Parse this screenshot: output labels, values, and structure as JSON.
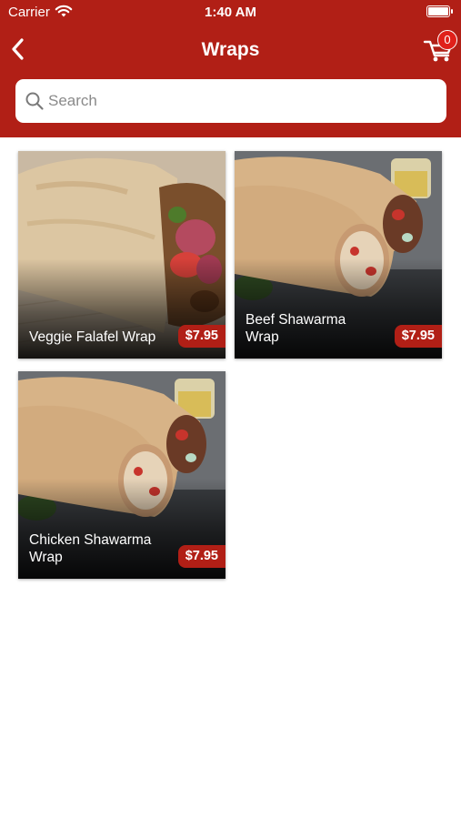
{
  "status_bar": {
    "carrier": "Carrier",
    "time": "1:40 AM"
  },
  "header": {
    "title": "Wraps",
    "cart_count": "0"
  },
  "search": {
    "placeholder": "Search",
    "value": ""
  },
  "products": [
    {
      "name": "Veggie Falafel Wrap",
      "price": "$7.95"
    },
    {
      "name": "Beef Shawarma Wrap",
      "price": "$7.95"
    },
    {
      "name": "Chicken Shawarma Wrap",
      "price": "$7.95"
    }
  ],
  "colors": {
    "brand": "#b11f16",
    "badge": "#e0201a",
    "background": "#ffffff"
  },
  "icons": [
    "wifi-icon",
    "battery-icon",
    "back-chevron-icon",
    "cart-icon",
    "search-icon"
  ]
}
